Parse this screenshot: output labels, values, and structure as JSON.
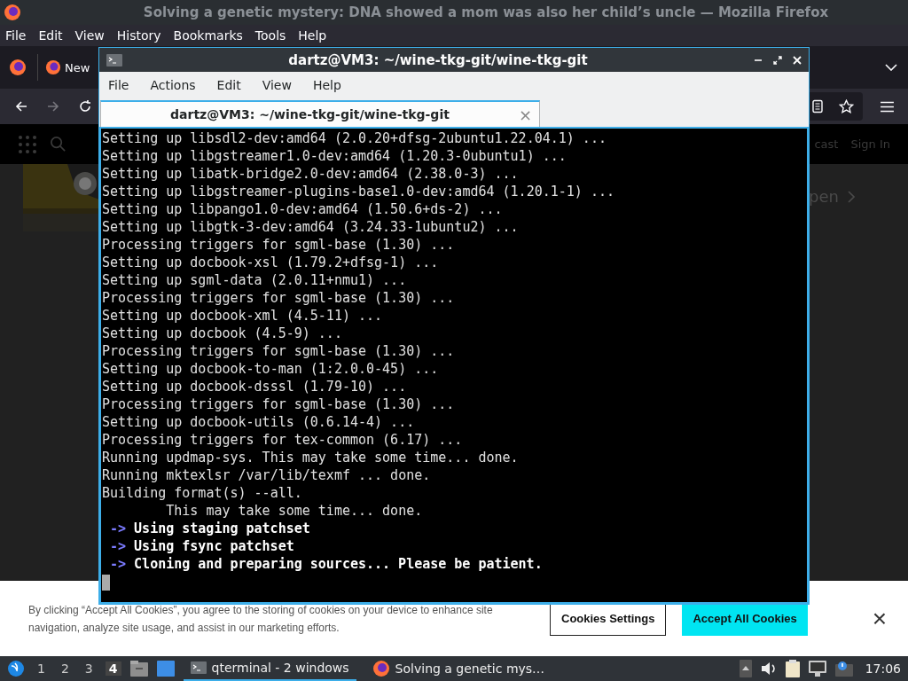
{
  "browser": {
    "title": "Solving a genetic mystery: DNA showed a mom was also her child’s uncle — Mozilla Firefox",
    "menu": [
      "File",
      "Edit",
      "View",
      "History",
      "Bookmarks",
      "Tools",
      "Help"
    ],
    "tab": {
      "label": "New"
    },
    "site_header": {
      "links": [
        "cast",
        "Sign In"
      ]
    },
    "site_link": "pen",
    "cookie_banner": {
      "text": "By clicking “Accept All Cookies”, you agree to the storing of cookies on your device to enhance site navigation, analyze site usage, and assist in our marketing efforts.",
      "buttons": [
        {
          "label": "Cookies Settings",
          "kind": "outline"
        },
        {
          "label": "Accept All Cookies",
          "kind": "primary"
        }
      ],
      "close": "×"
    }
  },
  "terminal": {
    "title": "dartz@VM3: ~/wine-tkg-git/wine-tkg-git",
    "menu": [
      "File",
      "Actions",
      "Edit",
      "View",
      "Help"
    ],
    "tabs": [
      {
        "label": "dartz@VM3: ~/wine-tkg-git/wine-tkg-git",
        "selected": true,
        "close": "×"
      }
    ],
    "lines": [
      {
        "kind": "plain",
        "text": "Setting up libsdl2-dev:amd64 (2.0.20+dfsg-2ubuntu1.22.04.1) ..."
      },
      {
        "kind": "plain",
        "text": "Setting up libgstreamer1.0-dev:amd64 (1.20.3-0ubuntu1) ..."
      },
      {
        "kind": "plain",
        "text": "Setting up libatk-bridge2.0-dev:amd64 (2.38.0-3) ..."
      },
      {
        "kind": "plain",
        "text": "Setting up libgstreamer-plugins-base1.0-dev:amd64 (1.20.1-1) ..."
      },
      {
        "kind": "plain",
        "text": "Setting up libpango1.0-dev:amd64 (1.50.6+ds-2) ..."
      },
      {
        "kind": "plain",
        "text": "Setting up libgtk-3-dev:amd64 (3.24.33-1ubuntu2) ..."
      },
      {
        "kind": "plain",
        "text": "Processing triggers for sgml-base (1.30) ..."
      },
      {
        "kind": "plain",
        "text": "Setting up docbook-xsl (1.79.2+dfsg-1) ..."
      },
      {
        "kind": "plain",
        "text": "Setting up sgml-data (2.0.11+nmu1) ..."
      },
      {
        "kind": "plain",
        "text": "Processing triggers for sgml-base (1.30) ..."
      },
      {
        "kind": "plain",
        "text": "Setting up docbook-xml (4.5-11) ..."
      },
      {
        "kind": "plain",
        "text": "Setting up docbook (4.5-9) ..."
      },
      {
        "kind": "plain",
        "text": "Processing triggers for sgml-base (1.30) ..."
      },
      {
        "kind": "plain",
        "text": "Setting up docbook-to-man (1:2.0.0-45) ..."
      },
      {
        "kind": "plain",
        "text": "Setting up docbook-dsssl (1.79-10) ..."
      },
      {
        "kind": "plain",
        "text": "Processing triggers for sgml-base (1.30) ..."
      },
      {
        "kind": "plain",
        "text": "Setting up docbook-utils (0.6.14-4) ..."
      },
      {
        "kind": "plain",
        "text": "Processing triggers for tex-common (6.17) ..."
      },
      {
        "kind": "plain",
        "text": "Running updmap-sys. This may take some time... done."
      },
      {
        "kind": "plain",
        "text": "Running mktexlsr /var/lib/texmf ... done."
      },
      {
        "kind": "plain",
        "text": "Building format(s) --all."
      },
      {
        "kind": "plain",
        "text": "        This may take some time... done."
      },
      {
        "kind": "step",
        "arrow": "->",
        "text": "Using staging patchset"
      },
      {
        "kind": "step",
        "arrow": "->",
        "text": "Using fsync patchset"
      },
      {
        "kind": "step",
        "arrow": "->",
        "text": "Cloning and preparing sources... Please be patient."
      }
    ]
  },
  "taskbar": {
    "desktops": [
      {
        "label": "1",
        "selected": false
      },
      {
        "label": "2",
        "selected": false
      },
      {
        "label": "3",
        "selected": false
      },
      {
        "label": "4",
        "selected": true
      }
    ],
    "tasks": [
      {
        "label": "qterminal - 2 windows",
        "selected": true,
        "kind": "terminal"
      },
      {
        "label": "Solving a genetic mys…",
        "selected": false,
        "kind": "firefox"
      }
    ],
    "clock": "17:06"
  }
}
